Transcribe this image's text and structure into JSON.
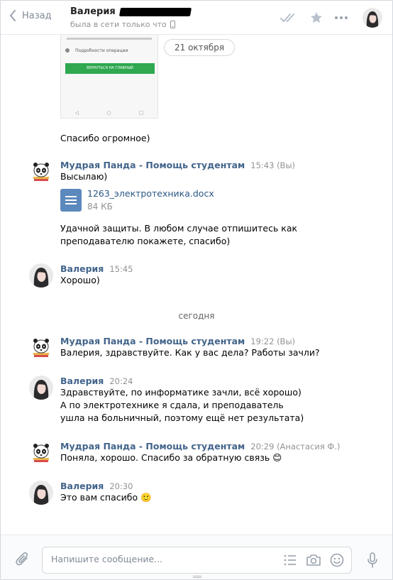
{
  "header": {
    "back_label": "Назад",
    "contact_name": "Валерия",
    "status": "была в сети только что"
  },
  "screenshot_preview": {
    "row_text": "Подробности операции",
    "button_text": "ВЕРНУТЬСЯ НА ГЛАВНЫЙ"
  },
  "date_pill": "21 октября",
  "messages": [
    {
      "text": "Спасибо огромное)"
    },
    {
      "author": "Мудрая Панда - Помощь студентам",
      "time": "15:43",
      "tag": "(Вы)",
      "text": "Высылаю)",
      "file": {
        "name": "1263_электротехника.docx",
        "size": "84 КБ"
      },
      "text2": "Удачной защиты. В любом случае отпишитесь как преподавателю покажете, спасибо)"
    },
    {
      "author": "Валерия",
      "time": "15:45",
      "text": "Хорошо)"
    },
    {
      "author": "Мудрая Панда - Помощь студентам",
      "time": "19:22",
      "tag": "(Вы)",
      "text": "Валерия, здравствуйте. Как у вас дела? Работы зачли?"
    },
    {
      "author": "Валерия",
      "time": "20:24",
      "text": "Здравствуйте, по информатике зачли, всё хорошо) А по электротехнике я сдала, и преподаватель ушла на больничный, поэтому ещё нет результата)"
    },
    {
      "author": "Мудрая Панда - Помощь студентам",
      "time": "20:29",
      "tag": "(Анастасия Ф.)",
      "text": "Поняла, хорошо. Спасибо за обратную связь 😊"
    },
    {
      "author": "Валерия",
      "time": "20:30",
      "text": "Это вам спасибо 🙂"
    }
  ],
  "today_divider": "сегодня",
  "composer": {
    "placeholder": "Напишите сообщение..."
  },
  "colors": {
    "link": "#42648b",
    "file_icon": "#5b88bd",
    "muted": "#939393"
  },
  "icons": [
    "chevron-left-icon",
    "double-check-icon",
    "star-icon",
    "more-icon",
    "phone-icon",
    "paperclip-icon",
    "list-icon",
    "camera-icon",
    "smile-icon",
    "microphone-icon",
    "document-icon"
  ]
}
